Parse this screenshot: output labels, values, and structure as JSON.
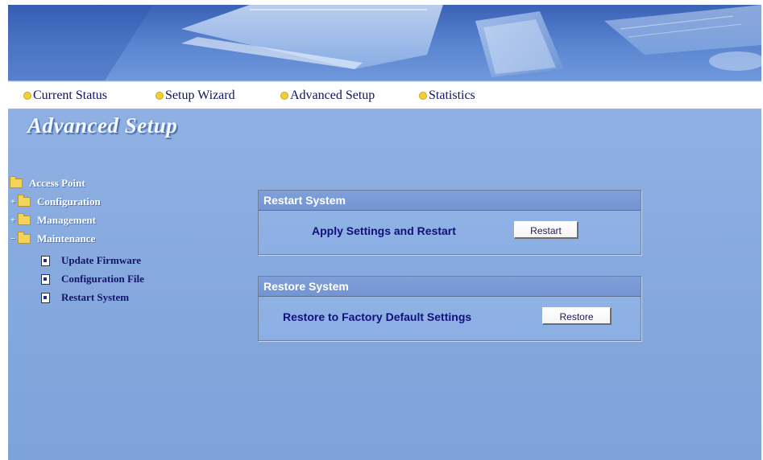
{
  "nav": {
    "items": [
      {
        "label": "Current Status"
      },
      {
        "label": "Setup Wizard"
      },
      {
        "label": "Advanced Setup"
      },
      {
        "label": "Statistics"
      }
    ]
  },
  "page_title": "Advanced Setup",
  "tree": {
    "root": "Access Point",
    "configuration": "Configuration",
    "management": "Management",
    "maintenance": "Maintenance",
    "update_firmware": "Update Firmware",
    "configuration_file": "Configuration File",
    "restart_system": "Restart System"
  },
  "panels": {
    "restart": {
      "title": "Restart System",
      "label": "Apply Settings and Restart",
      "button": "Restart"
    },
    "restore": {
      "title": "Restore System",
      "label": "Restore to Factory Default Settings",
      "button": "Restore"
    }
  },
  "icons": {
    "nav_bullet": "yellow-dot-icon",
    "folder": "folder-icon",
    "page": "page-icon",
    "expand": "plus-icon"
  },
  "colors": {
    "nav_bullet": "#f0cf38",
    "nav_text": "#13135a",
    "panel_label": "#10107a",
    "tree_folder_text": "#ffffff",
    "tree_page_text": "#14146a"
  }
}
